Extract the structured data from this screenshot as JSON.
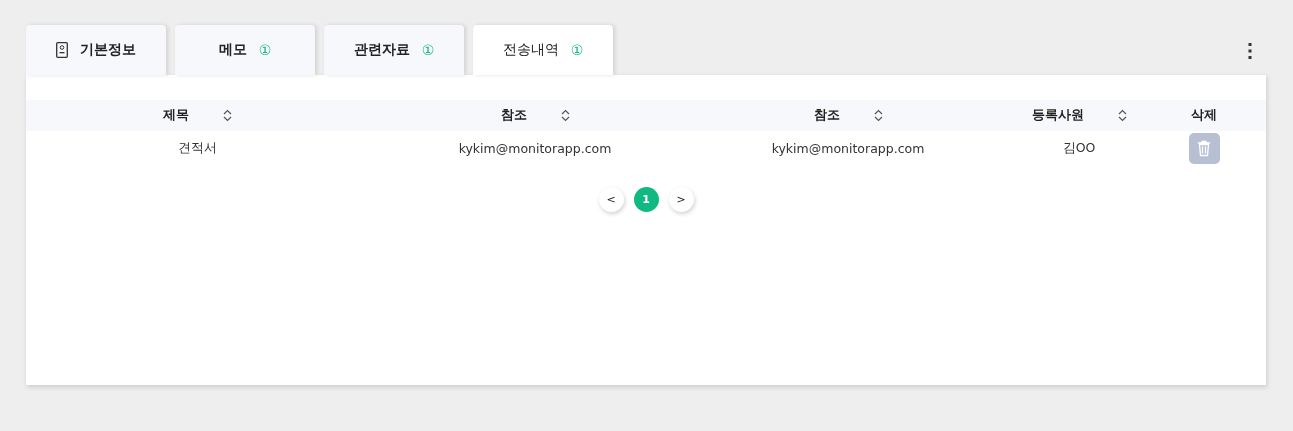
{
  "tabs": [
    {
      "label": "기본정보",
      "kind": "icon",
      "selected": false
    },
    {
      "label": "메모",
      "badge": "①",
      "selected": false
    },
    {
      "label": "관련자료",
      "badge": "①",
      "selected": false
    },
    {
      "label": "전송내역",
      "badge": "①",
      "selected": true
    }
  ],
  "table": {
    "columns": [
      {
        "label": "제목",
        "sortable": true
      },
      {
        "label": "참조",
        "sortable": true
      },
      {
        "label": "참조",
        "sortable": true
      },
      {
        "label": "등록사원",
        "sortable": true
      },
      {
        "label": "삭제",
        "sortable": false
      }
    ],
    "rows": [
      {
        "cells": [
          "견적서",
          "kykim@monitorapp.com",
          "kykim@monitorapp.com",
          "김OO"
        ],
        "deletable": true
      }
    ]
  },
  "pagination": {
    "previous": "<",
    "pages": [
      {
        "label": "1",
        "selected": true
      }
    ],
    "next": ">"
  }
}
